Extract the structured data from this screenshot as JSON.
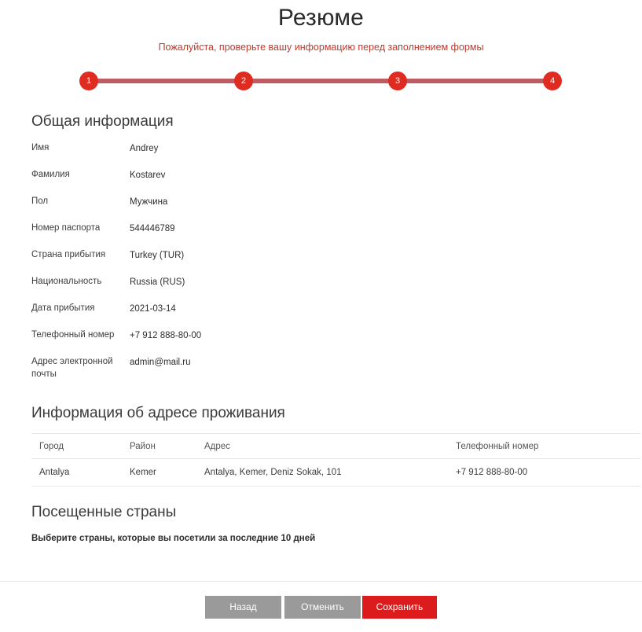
{
  "header": {
    "title": "Резюме",
    "subtitle": "Пожалуйста, проверьте вашу информацию перед заполнением формы"
  },
  "stepper": {
    "steps": [
      {
        "number": "1",
        "position_pct": 0
      },
      {
        "number": "2",
        "position_pct": 33.4
      },
      {
        "number": "3",
        "position_pct": 66.6
      },
      {
        "number": "4",
        "position_pct": 100
      }
    ],
    "active_color": "#e02b20",
    "track_color": "#bf5b62"
  },
  "general": {
    "heading": "Общая информация",
    "fields": [
      {
        "label": "Имя",
        "value": "Andrey"
      },
      {
        "label": "Фамилия",
        "value": "Kostarev"
      },
      {
        "label": "Пол",
        "value": "Мужчина"
      },
      {
        "label": "Номер паспорта",
        "value": "544446789"
      },
      {
        "label": "Страна прибытия",
        "value": "Turkey (TUR)"
      },
      {
        "label": "Национальность",
        "value": "Russia (RUS)"
      },
      {
        "label": "Дата прибытия",
        "value": "2021-03-14"
      },
      {
        "label": "Телефонный номер",
        "value": "+7 912 888-80-00"
      },
      {
        "label": "Адрес электронной почты",
        "value": "admin@mail.ru"
      }
    ]
  },
  "address": {
    "heading": "Информация об адресе проживания",
    "columns": [
      "Город",
      "Район",
      "Адрес",
      "Телефонный номер"
    ],
    "rows": [
      {
        "city": "Antalya",
        "region": "Kemer",
        "address": "Antalya, Kemer, Deniz Sokak, 101",
        "phone": "+7 912 888-80-00"
      }
    ]
  },
  "countries": {
    "heading": "Посещенные страны",
    "hint": "Выберите страны, которые вы посетили за последние 10 дней"
  },
  "footer": {
    "back_label": "Назад",
    "cancel_label": "Отменить",
    "save_label": "Сохранить",
    "primary_color": "#dc1c1c",
    "secondary_color": "#9a9a9a"
  }
}
